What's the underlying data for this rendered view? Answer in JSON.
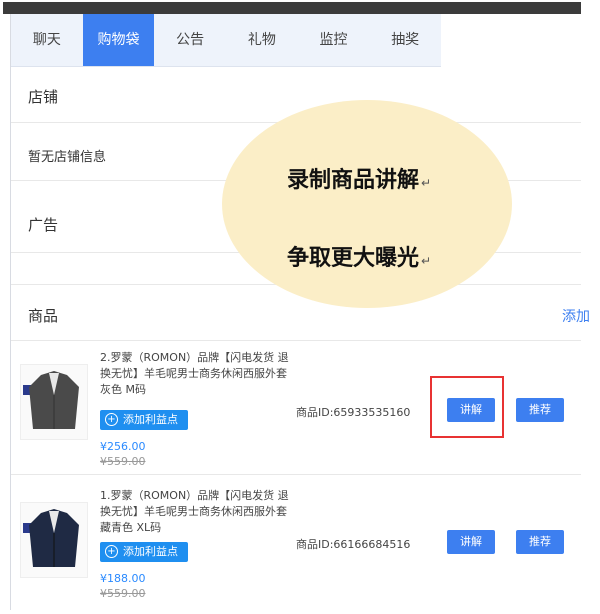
{
  "tabs": [
    {
      "label": "聊天"
    },
    {
      "label": "购物袋"
    },
    {
      "label": "公告"
    },
    {
      "label": "礼物"
    },
    {
      "label": "监控"
    },
    {
      "label": "抽奖"
    }
  ],
  "active_tab": 1,
  "shop_section": {
    "label": "店铺",
    "empty_text": "暂无店铺信息"
  },
  "ad_section": {
    "label": "广告"
  },
  "overlay": {
    "line1": "录制商品讲解",
    "line2": "争取更大曝光",
    "return_mark": "↵"
  },
  "products_section": {
    "label": "商品",
    "add_label": "添加"
  },
  "products": [
    {
      "title": "2.罗蒙（ROMON）品牌【闪电发货 退换无忧】羊毛呢男士商务休闲西服外套 灰色 M码",
      "tag_button": "添加利益点",
      "price": "¥256.00",
      "original_price": "¥559.00",
      "product_id": "商品ID:659335351​60",
      "explain_label": "讲解",
      "recommend_label": "推荐",
      "jacket_color": "#4a4a4a"
    },
    {
      "title": "1.罗蒙（ROMON）品牌【闪电发货 退换无忧】羊毛呢男士商务休闲西服外套 藏青色 XL码",
      "tag_button": "添加利益点",
      "price": "¥188.00",
      "original_price": "¥559.00",
      "product_id": "商品ID:66166684516",
      "explain_label": "讲解",
      "recommend_label": "推荐",
      "jacket_color": "#1f2a44"
    }
  ],
  "colors": {
    "accent": "#3d7ff0",
    "highlight": "#e83232",
    "bubble": "#fbeec7"
  }
}
